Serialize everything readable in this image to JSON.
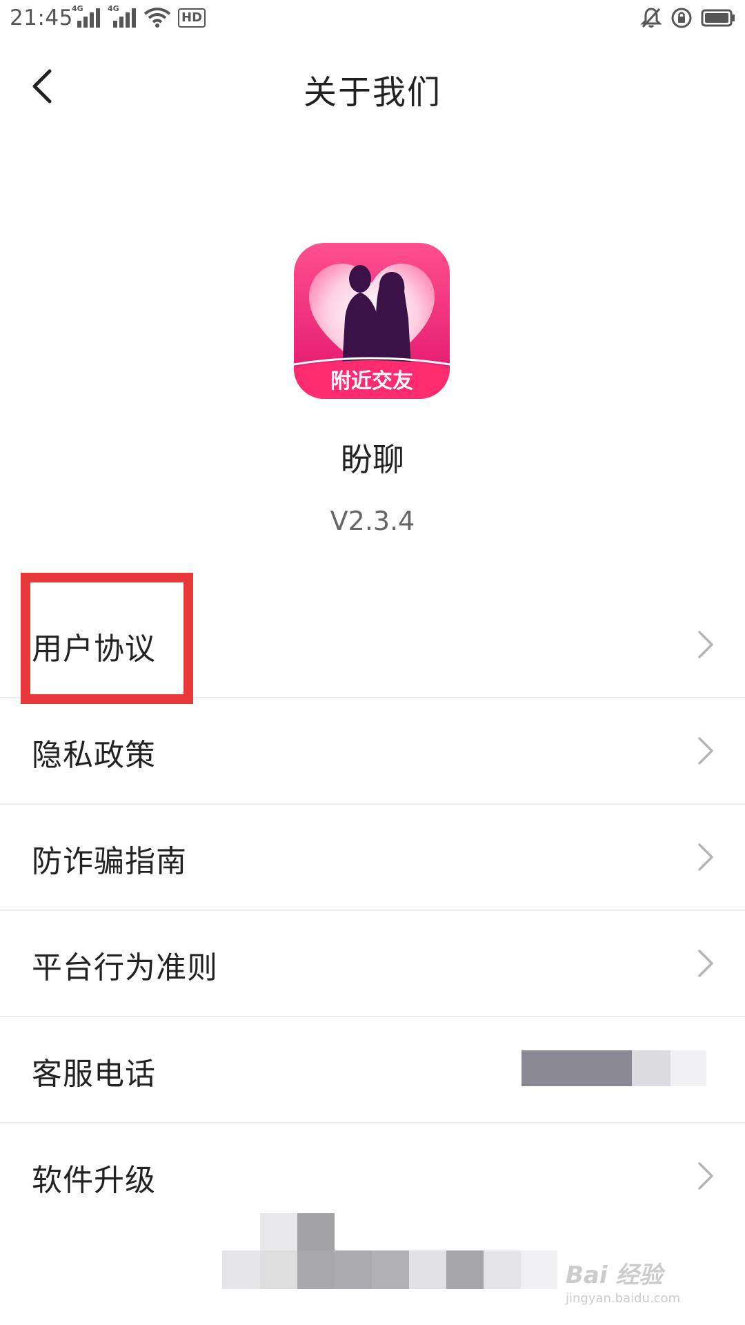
{
  "status_bar": {
    "time": "21:45",
    "network_tag_1": "4G",
    "network_tag_2": "4G",
    "hd_label": "HD",
    "icons": [
      "signal-icon",
      "signal-icon",
      "wifi-icon",
      "hd-icon",
      "mute-icon",
      "rotation-lock-icon",
      "battery-icon"
    ]
  },
  "header": {
    "title": "关于我们",
    "back_icon": "chevron-left-icon"
  },
  "app": {
    "name": "盼聊",
    "version": "V2.3.4",
    "logo_text": "附近交友",
    "logo_colors": [
      "#ff3d7a",
      "#d61f6e",
      "#ff8fb8"
    ]
  },
  "menu": {
    "items": [
      {
        "label": "用户协议",
        "icon": "chevron-right-icon"
      },
      {
        "label": "隐私政策",
        "icon": "chevron-right-icon"
      },
      {
        "label": "防诈骗指南",
        "icon": "chevron-right-icon"
      },
      {
        "label": "平台行为准则",
        "icon": "chevron-right-icon"
      },
      {
        "label": "客服电话",
        "icon": "chevron-right-icon"
      },
      {
        "label": "软件升级",
        "icon": "chevron-right-icon"
      }
    ]
  },
  "annotation": {
    "highlight_color": "#e8383a"
  },
  "watermark": {
    "main": "Bai 经验",
    "sub": "jingyan.baidu.com"
  }
}
